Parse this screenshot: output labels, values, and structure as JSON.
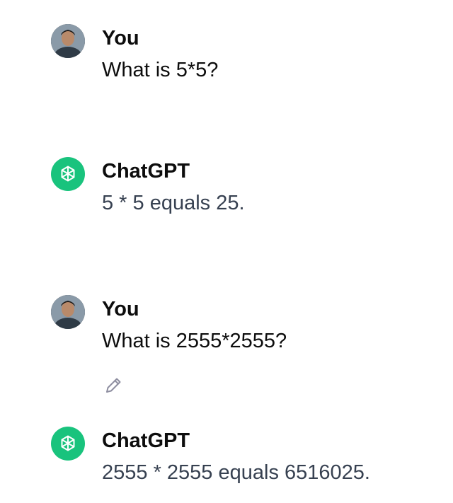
{
  "conversation": {
    "messages": [
      {
        "role": "user",
        "author": "You",
        "text": "What is 5*5?"
      },
      {
        "role": "assistant",
        "author": "ChatGPT",
        "text": "5 * 5 equals 25."
      },
      {
        "role": "user",
        "author": "You",
        "text": "What is 2555*2555?",
        "actions": [
          "pencil-icon"
        ]
      },
      {
        "role": "assistant",
        "author": "ChatGPT",
        "text": "2555 * 2555 equals 6516025."
      }
    ]
  },
  "colors": {
    "gpt_avatar_bg": "#19c37d",
    "author_text": "#0d0d0d",
    "assistant_text": "#374151",
    "edit_icon": "#8e8ea0"
  },
  "icons": {
    "user_avatar": "user-avatar-photo",
    "assistant_avatar": "openai-logo-icon",
    "edit": "pencil-icon"
  }
}
